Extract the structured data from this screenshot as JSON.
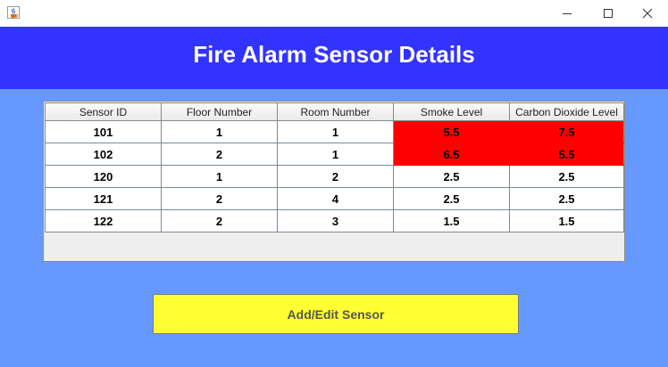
{
  "window": {
    "icon": "java-cup-icon",
    "controls": {
      "minimize": "minimize-icon",
      "maximize": "maximize-icon",
      "close": "close-icon"
    }
  },
  "header": {
    "title": "Fire Alarm Sensor Details"
  },
  "table": {
    "columns": [
      "Sensor ID",
      "Floor Number",
      "Room Number",
      "Smoke Level",
      "Carbon Dioxide Level"
    ],
    "rows": [
      {
        "cells": [
          "101",
          "1",
          "1",
          "5.5",
          "7.5"
        ],
        "alert": true
      },
      {
        "cells": [
          "102",
          "2",
          "1",
          "6.5",
          "5.5"
        ],
        "alert": true
      },
      {
        "cells": [
          "120",
          "1",
          "2",
          "2.5",
          "2.5"
        ],
        "alert": false
      },
      {
        "cells": [
          "121",
          "2",
          "4",
          "2.5",
          "2.5"
        ],
        "alert": false
      },
      {
        "cells": [
          "122",
          "2",
          "3",
          "1.5",
          "1.5"
        ],
        "alert": false
      }
    ]
  },
  "actions": {
    "add_edit_label": "Add/Edit Sensor"
  },
  "colors": {
    "header_bg": "#3333ff",
    "main_bg": "#6699ff",
    "alert_bg": "#ff0000",
    "button_bg": "#ffff33"
  }
}
